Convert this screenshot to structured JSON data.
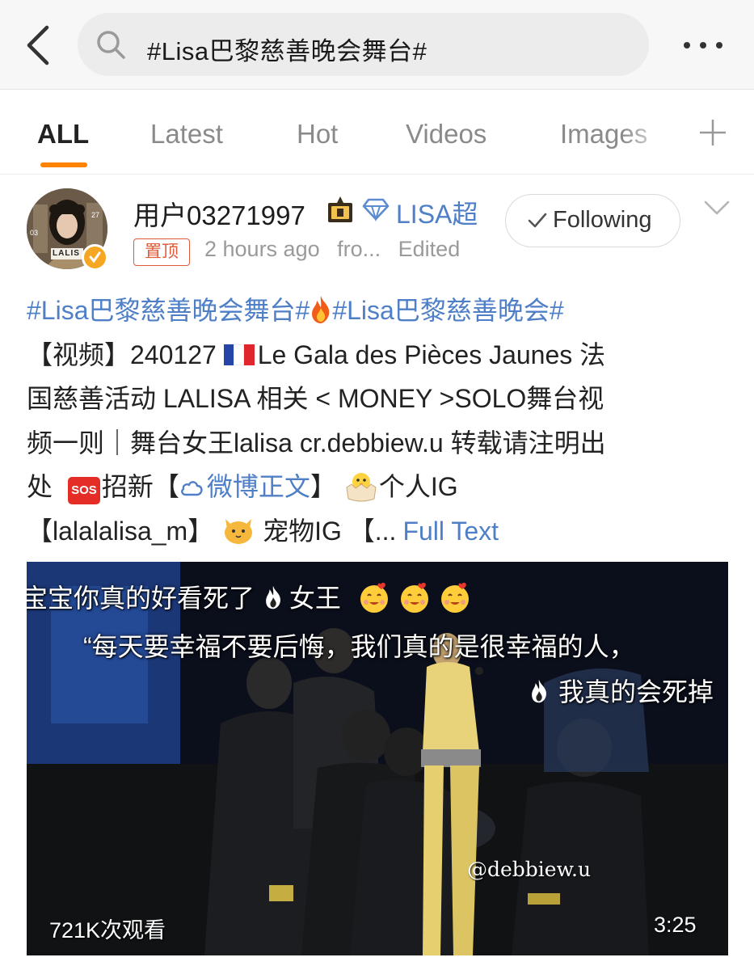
{
  "search": {
    "query": "#Lisa巴黎慈善晚会舞台#"
  },
  "tabs": [
    {
      "label": "ALL"
    },
    {
      "label": "Latest"
    },
    {
      "label": "Hot"
    },
    {
      "label": "Videos"
    },
    {
      "label": "Images"
    }
  ],
  "post": {
    "username": "用户03271997",
    "fanclub_label": "LISA超",
    "pinned_label": "置顶",
    "time": "2 hours ago",
    "source": "fro...",
    "edited": "Edited",
    "follow_label": "Following",
    "avatar_text": "LALIS",
    "body": {
      "topic1": "#Lisa巴黎慈善晚会舞台#",
      "topic2": "#Lisa巴黎慈善晚会#",
      "line2_prefix": "【视频】240127 ",
      "line2_rest": "Le Gala des Pièces Jaunes 法",
      "line3": "国慈善活动 LALISA 相关 < MONEY >SOLO舞台视",
      "line4": "频一则｜舞台女王lalisa  cr.debbiew.u 转载请注明出",
      "line5_a": "处 ",
      "sos_label": "SOS",
      "line5_b": "招新【",
      "weibo_link": "微博正文",
      "line5_c": "】 ",
      "line5_d": "个人IG",
      "line6_a": "【lalalalisa_m】 ",
      "line6_b": "宠物IG 【...",
      "full_text": "Full Text"
    },
    "video": {
      "danmaku1": "宝宝你真的好看死了  ",
      "danmaku1_b": "女王",
      "danmaku2": "“每天要幸福不要后悔，我们真的是很幸福的人，",
      "danmaku3": "我真的会死掉",
      "watermark": "@debbiew.u",
      "views": "721K次观看",
      "duration": "3:25"
    }
  },
  "colors": {
    "accent": "#ff8200",
    "link": "#4f7fc7",
    "pin": "#e05a3a"
  },
  "icons": [
    "back-icon",
    "search-icon",
    "more-icon",
    "plus-icon",
    "crown-icon",
    "diamond-icon",
    "check-icon",
    "chevron-down-icon",
    "fire-icon",
    "flag-fr-icon",
    "sos-icon",
    "cloud-icon",
    "chick-icon",
    "cat-icon",
    "heart-face-emoji-icon"
  ]
}
